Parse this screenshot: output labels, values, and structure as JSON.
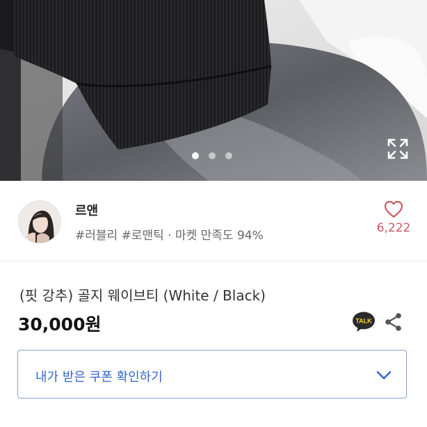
{
  "hero": {
    "slide_count": 3,
    "active_slide": 1
  },
  "seller": {
    "name": "르앤",
    "tags": "#러블리 #로맨틱 · 마켓 만족도 94%",
    "like_count": "6,222"
  },
  "product": {
    "title": "(핏 강추) 골지 웨이브티 (White / Black)",
    "price": "30,000원"
  },
  "talk_icon_label": "TALK",
  "coupon": {
    "label": "내가 받은 쿠폰 확인하기"
  },
  "colors": {
    "like": "#c95a65",
    "coupon_text": "#3366cc",
    "coupon_border": "#8ba0d6",
    "talk_bg": "#2b2b2b",
    "talk_text": "#f5d428"
  }
}
